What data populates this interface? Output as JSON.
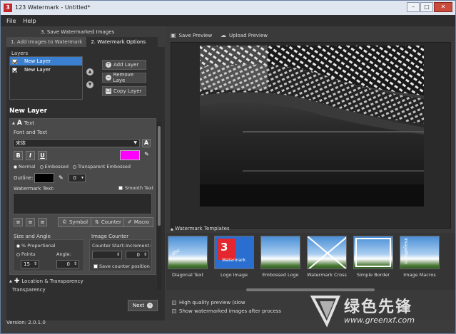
{
  "window": {
    "title": "123 Watermark - Untitled*",
    "app_icon_glyph": "3",
    "buttons": {
      "minimize": "–",
      "maximize": "□",
      "close": "✕"
    }
  },
  "menu": {
    "items": [
      "File",
      "Help"
    ]
  },
  "left": {
    "step3_tab": "3. Save Watermarked Images",
    "tabs": [
      "1. Add Images to Watermark",
      "2. Watermark Options"
    ],
    "layers_label": "Layers",
    "layers": [
      {
        "label": "New Layer",
        "checked": true,
        "selected": true
      },
      {
        "label": "New Layer",
        "checked": true,
        "selected": false
      }
    ],
    "layer_buttons": {
      "add": "Add Layer",
      "remove": "Remove Laye",
      "copy": "Copy Layer"
    },
    "section_title": "New Layer",
    "text_section": "Text",
    "font_and_text": "Font and Text",
    "font_name": "宋体",
    "bold": "B",
    "italic": "I",
    "underline": "U",
    "text_color": "#ff00ff",
    "style_options": [
      "Normal",
      "Embossed",
      "Transparent Embossed"
    ],
    "style_selected": "Normal",
    "outline_label": "Outline:",
    "outline_color": "#000000",
    "outline_width": "0",
    "watermark_text_label": "Watermark Text:",
    "smooth_text": "Smooth Text",
    "tools": {
      "symbol": "Symbol",
      "counter": "Counter",
      "macro": "Macro"
    },
    "size_and_angle": "Size and Angle",
    "proportional": "% Proportional",
    "points": "Points",
    "angle_label": "Angle:",
    "size_value": "15",
    "angle_value": "0",
    "image_counter": "Image Counter",
    "counter_start": "Counter Start:",
    "increment": "Increment:",
    "increment_value": "0",
    "save_counter": "Save counter position",
    "location_section": "Location & Transparency",
    "transparency": "Transparency",
    "next": "Next",
    "version": "Version: 2.0.1.0"
  },
  "right": {
    "save_preview": "Save Preview",
    "upload_preview": "Upload Preview",
    "templates_header": "Watermark Templates",
    "templates": [
      "Diagonal Text",
      "Logo Image",
      "Embossed Logo",
      "Watermark Cross",
      "Simple Border",
      "Image Macros"
    ],
    "hq_preview": "High quality preview (slow",
    "show_watermarked": "Show watermarked images after process"
  },
  "site_watermark": {
    "text": "绿色先锋",
    "url": "www.greenxf.com"
  }
}
